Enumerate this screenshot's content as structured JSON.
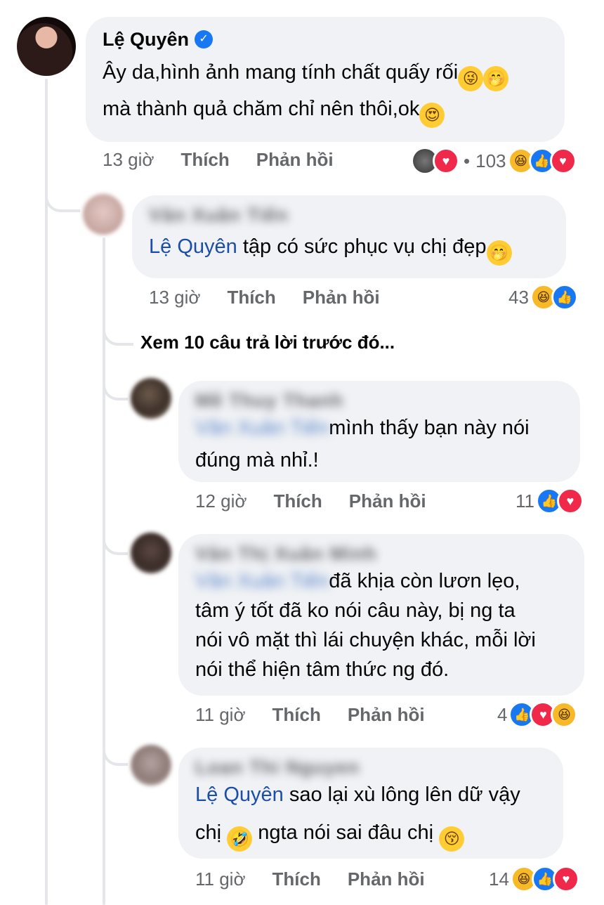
{
  "comments": [
    {
      "author": "Lệ Quyên",
      "verified": true,
      "text_line1": "Ây da,hình ảnh mang tính chất quấy rối",
      "text_line2": "mà thành quả chăm chỉ nên thôi,ok",
      "time": "13 giờ",
      "like_label": "Thích",
      "reply_label": "Phản hồi",
      "reaction_separator": "•",
      "reaction_count": "103"
    },
    {
      "author": "Văn Xuân Tiến",
      "mention": "Lệ Quyên",
      "text": " tập có sức phục vụ chị đẹp",
      "time": "13 giờ",
      "like_label": "Thích",
      "reply_label": "Phản hồi",
      "reaction_count": "43"
    }
  ],
  "see_previous": "Xem 10 câu trả lời trước đó...",
  "replies": [
    {
      "author": "Mề Thuy Thanh",
      "mention": "Văn Xuân Tiến",
      "text_line1": "mình thấy bạn này nói",
      "text_line2": "đúng mà nhỉ.!",
      "time": "12 giờ",
      "like_label": "Thích",
      "reply_label": "Phản hồi",
      "reaction_count": "11"
    },
    {
      "author": "Văn Thị Xuân Minh",
      "mention": "Văn Xuân Tiến",
      "text_line1": "đã khịa còn lươn lẹo,",
      "text_line2": "tâm ý tốt đã ko nói câu này, bị ng ta",
      "text_line3": "nói vô mặt thì lái chuyện khác, mỗi lời",
      "text_line4": "nói thể hiện tâm thức ng đó.",
      "time": "11 giờ",
      "like_label": "Thích",
      "reply_label": "Phản hồi",
      "reaction_count": "4"
    },
    {
      "author": "Loan Thi Nguyen",
      "mention": "Lệ Quyên",
      "text_line1": " sao lại xù lông lên dữ vậy",
      "text_line2a": "chị ",
      "text_line2b": " ngta nói sai đâu chị ",
      "time": "11 giờ",
      "like_label": "Thích",
      "reply_label": "Phản hồi",
      "reaction_count": "14"
    }
  ],
  "colors": {
    "bubble": "#f0f2f5",
    "mention": "#1b4ea8",
    "meta": "#65676b",
    "like": "#1877f2",
    "love": "#f02849",
    "haha": "#f7b928"
  }
}
